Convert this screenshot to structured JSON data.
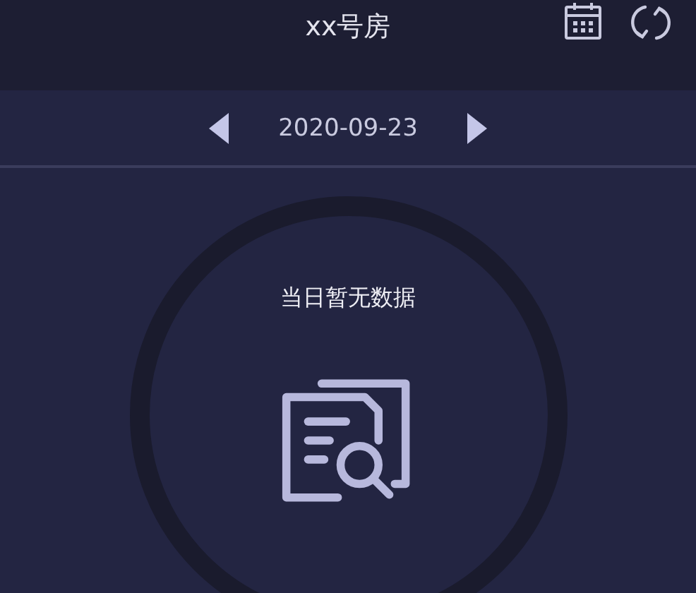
{
  "header": {
    "title": "xx号房"
  },
  "date_bar": {
    "date": "2020-09-23"
  },
  "empty_state": {
    "message": "当日暂无数据"
  }
}
